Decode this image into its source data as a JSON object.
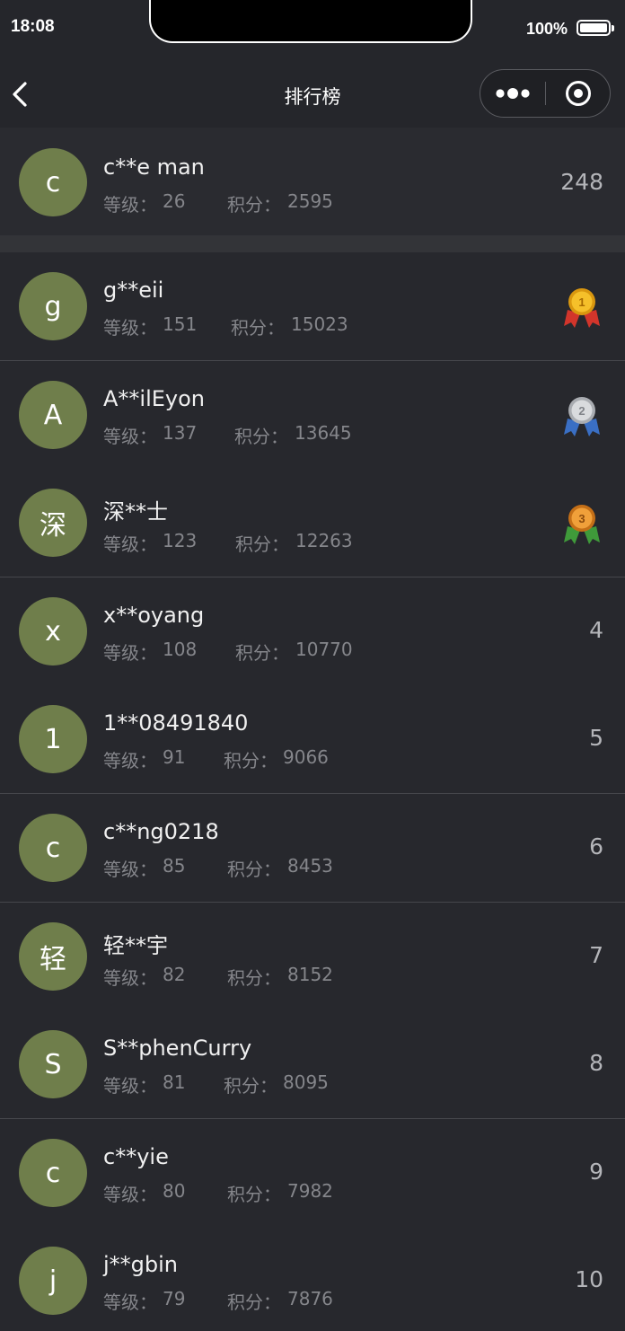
{
  "status_bar": {
    "time": "18:08",
    "battery": "100%"
  },
  "nav": {
    "title": "排行榜"
  },
  "labels": {
    "level": "等级：",
    "score": "积分："
  },
  "me": {
    "avatar": "c",
    "name": "c**e man",
    "level": "26",
    "score": "2595",
    "rank": "248"
  },
  "ranking": [
    {
      "avatar": "g",
      "name": "g**eii",
      "level": "151",
      "score": "15023",
      "medal": "gold",
      "medal_number": "1"
    },
    {
      "avatar": "A",
      "name": "A**ilEyon",
      "level": "137",
      "score": "13645",
      "medal": "silver",
      "medal_number": "2"
    },
    {
      "avatar": "深",
      "name": "深**士",
      "level": "123",
      "score": "12263",
      "medal": "bronze",
      "medal_number": "3"
    },
    {
      "avatar": "x",
      "name": "x**oyang",
      "level": "108",
      "score": "10770",
      "rank": "4"
    },
    {
      "avatar": "1",
      "name": "1**08491840",
      "level": "91",
      "score": "9066",
      "rank": "5"
    },
    {
      "avatar": "c",
      "name": "c**ng0218",
      "level": "85",
      "score": "8453",
      "rank": "6"
    },
    {
      "avatar": "轻",
      "name": "轻**宇",
      "level": "82",
      "score": "8152",
      "rank": "7"
    },
    {
      "avatar": "S",
      "name": "S**phenCurry",
      "level": "81",
      "score": "8095",
      "rank": "8"
    },
    {
      "avatar": "c",
      "name": "c**yie",
      "level": "80",
      "score": "7982",
      "rank": "9"
    },
    {
      "avatar": "j",
      "name": "j**gbin",
      "level": "79",
      "score": "7876",
      "rank": "10"
    }
  ],
  "colors": {
    "background": "#25262b",
    "avatar": "#6f7e4b",
    "gold": "#f2b21c",
    "silver": "#c7c9cc",
    "bronze": "#e58a2c"
  },
  "icons": {
    "back": "chevron-left-icon",
    "more": "more-dots-icon",
    "close": "target-close-icon"
  }
}
